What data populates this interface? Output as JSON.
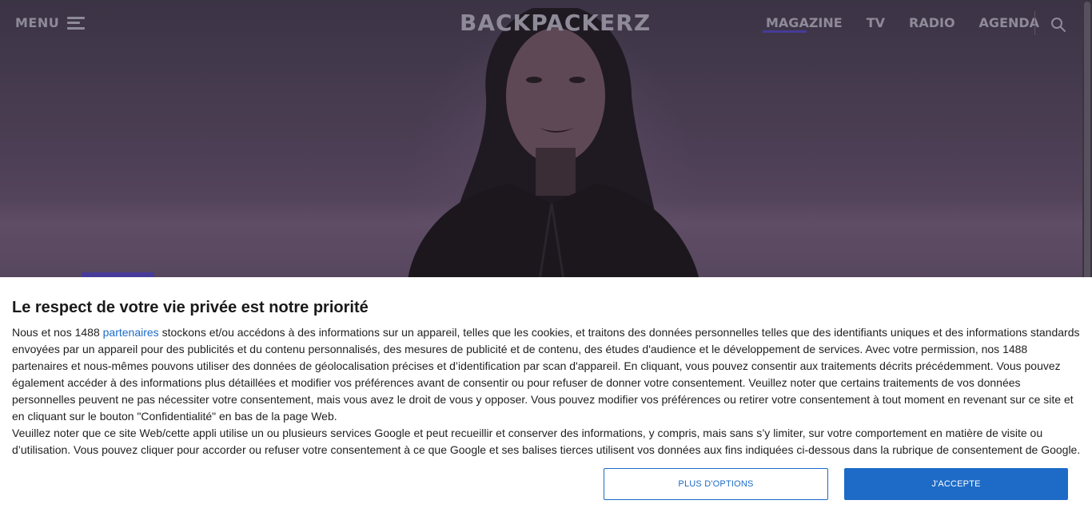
{
  "header": {
    "menu_label": "MENU",
    "logo": "BACKPACKERZ",
    "nav": [
      {
        "label": "MAGAZINE"
      },
      {
        "label": "TV"
      },
      {
        "label": "RADIO"
      },
      {
        "label": "AGENDA"
      }
    ]
  },
  "consent": {
    "title": "Le respect de votre vie privée est notre priorité",
    "para1_before_link": "Nous et nos 1488 ",
    "link_text": "partenaires",
    "para1_after_link": " stockons et/ou accédons à des informations sur un appareil, telles que les cookies, et traitons des données personnelles telles que des identifiants uniques et des informations standards envoyées par un appareil pour des publicités et du contenu personnalisés, des mesures de publicité et de contenu, des études d'audience et le développement de services. Avec votre permission, nos 1488 partenaires et nous-mêmes pouvons utiliser des données de géolocalisation précises et d’identification par scan d'appareil. En cliquant, vous pouvez consentir aux traitements décrits précédemment. Vous pouvez également accéder à des informations plus détaillées et modifier vos préférences avant de consentir ou pour refuser de donner votre consentement. Veuillez noter que certains traitements de vos données personnelles peuvent ne pas nécessiter votre consentement, mais vous avez le droit de vous y opposer. Vous pouvez modifier vos préférences ou retirer votre consentement à tout moment en revenant sur ce site et en cliquant sur le bouton \"Confidentialité\" en bas de la page Web.",
    "para2": "Veuillez noter que ce site Web/cette appli utilise un ou plusieurs services Google et peut recueillir et conserver des informations, y compris, mais sans s’y limiter, sur votre comportement en matière de visite ou d’utilisation. Vous pouvez cliquer pour accorder ou refuser votre consentement à ce que Google et ses balises tierces utilisent vos données aux fins indiquées ci-dessous dans la rubrique de consentement de Google.",
    "options_label": "PLUS D'OPTIONS",
    "accept_label": "J'ACCEPTE"
  },
  "colors": {
    "accent": "#473b9a",
    "button_blue": "#1d6bc7"
  }
}
